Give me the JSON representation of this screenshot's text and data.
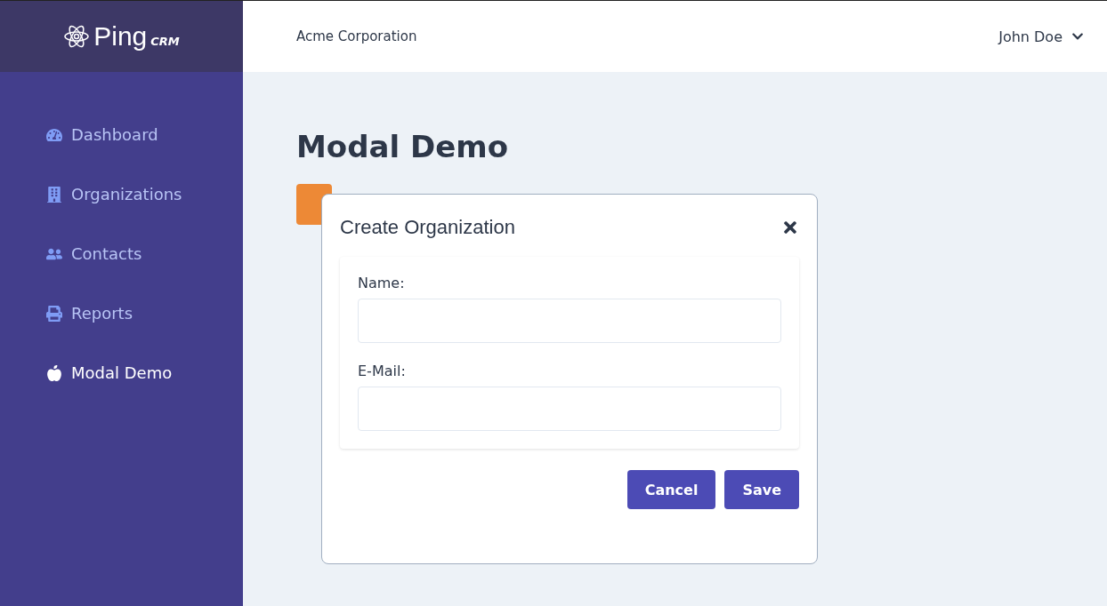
{
  "logo": {
    "name": "Ping",
    "suffix": "CRM"
  },
  "header": {
    "organization": "Acme Corporation",
    "user": "John Doe"
  },
  "sidebar": {
    "items": [
      {
        "label": "Dashboard",
        "selected": false
      },
      {
        "label": "Organizations",
        "selected": false
      },
      {
        "label": "Contacts",
        "selected": false
      },
      {
        "label": "Reports",
        "selected": false
      },
      {
        "label": "Modal Demo",
        "selected": true
      }
    ]
  },
  "page": {
    "title": "Modal Demo"
  },
  "modal": {
    "title": "Create Organization",
    "fields": [
      {
        "label": "Name:"
      },
      {
        "label": "E-Mail:"
      }
    ],
    "buttons": [
      "Cancel",
      "Save"
    ]
  }
}
